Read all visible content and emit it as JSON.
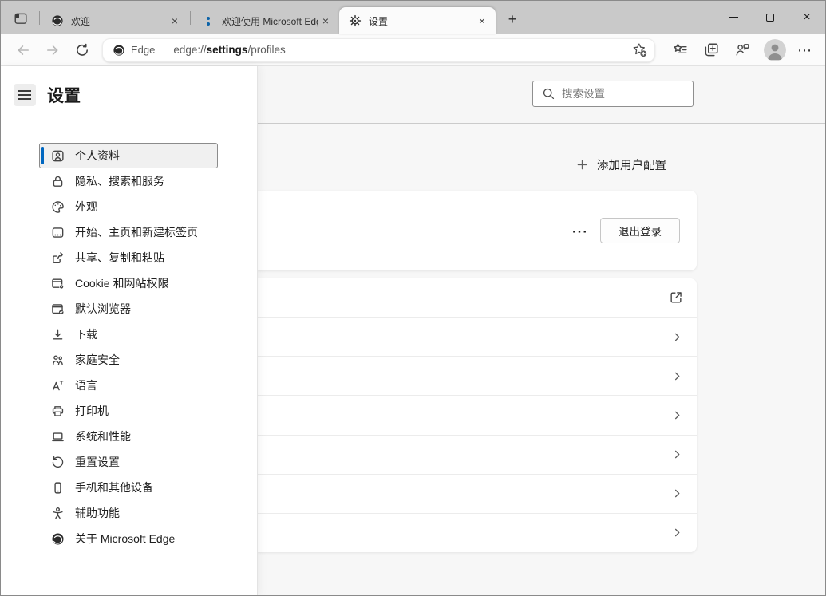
{
  "glyphs": {
    "close": "×",
    "plus": "+",
    "more": "⋯",
    "card_more": "···"
  },
  "tabbar": {
    "tabs": [
      {
        "title": "欢迎",
        "icon": "edge-logo",
        "active": false
      },
      {
        "title": "欢迎使用 Microsoft Edg",
        "icon": "blue-dots",
        "active": false
      },
      {
        "title": "设置",
        "icon": "gear",
        "active": true
      }
    ]
  },
  "toolbar": {
    "site_badge": "Edge",
    "url_prefix": "edge://",
    "url_highlight": "settings",
    "url_suffix": "/profiles"
  },
  "sidebar": {
    "title": "设置",
    "items": [
      {
        "label": "个人资料",
        "icon": "profile-badge",
        "selected": true
      },
      {
        "label": "隐私、搜索和服务",
        "icon": "lock",
        "selected": false
      },
      {
        "label": "外观",
        "icon": "palette",
        "selected": false
      },
      {
        "label": "开始、主页和新建标签页",
        "icon": "home-layout",
        "selected": false
      },
      {
        "label": "共享、复制和粘贴",
        "icon": "share",
        "selected": false
      },
      {
        "label": "Cookie 和网站权限",
        "icon": "site-permissions",
        "selected": false
      },
      {
        "label": "默认浏览器",
        "icon": "default-browser",
        "selected": false
      },
      {
        "label": "下载",
        "icon": "download",
        "selected": false
      },
      {
        "label": "家庭安全",
        "icon": "family",
        "selected": false
      },
      {
        "label": "语言",
        "icon": "language",
        "selected": false
      },
      {
        "label": "打印机",
        "icon": "printer",
        "selected": false
      },
      {
        "label": "系统和性能",
        "icon": "system",
        "selected": false
      },
      {
        "label": "重置设置",
        "icon": "reset",
        "selected": false
      },
      {
        "label": "手机和其他设备",
        "icon": "phone",
        "selected": false
      },
      {
        "label": "辅助功能",
        "icon": "accessibility",
        "selected": false
      },
      {
        "label": "关于 Microsoft Edge",
        "icon": "edge-logo",
        "selected": false
      }
    ]
  },
  "main": {
    "search_placeholder": "搜索设置",
    "add_profile_label": "添加用户配置",
    "profile_card": {
      "more": "···",
      "signout_label": "退出登录"
    },
    "settings_rows": [
      {
        "icon": "external-link"
      },
      {
        "icon": "chevron-right"
      },
      {
        "icon": "chevron-right"
      },
      {
        "icon": "chevron-right"
      },
      {
        "icon": "chevron-right"
      },
      {
        "icon": "chevron-right"
      },
      {
        "icon": "chevron-right"
      }
    ]
  },
  "colors": {
    "accent": "#0067c0",
    "titlebar_bg": "#c9c9c9",
    "content_bg": "#f7f7f7",
    "favicon_blue": "#0b62a8"
  }
}
